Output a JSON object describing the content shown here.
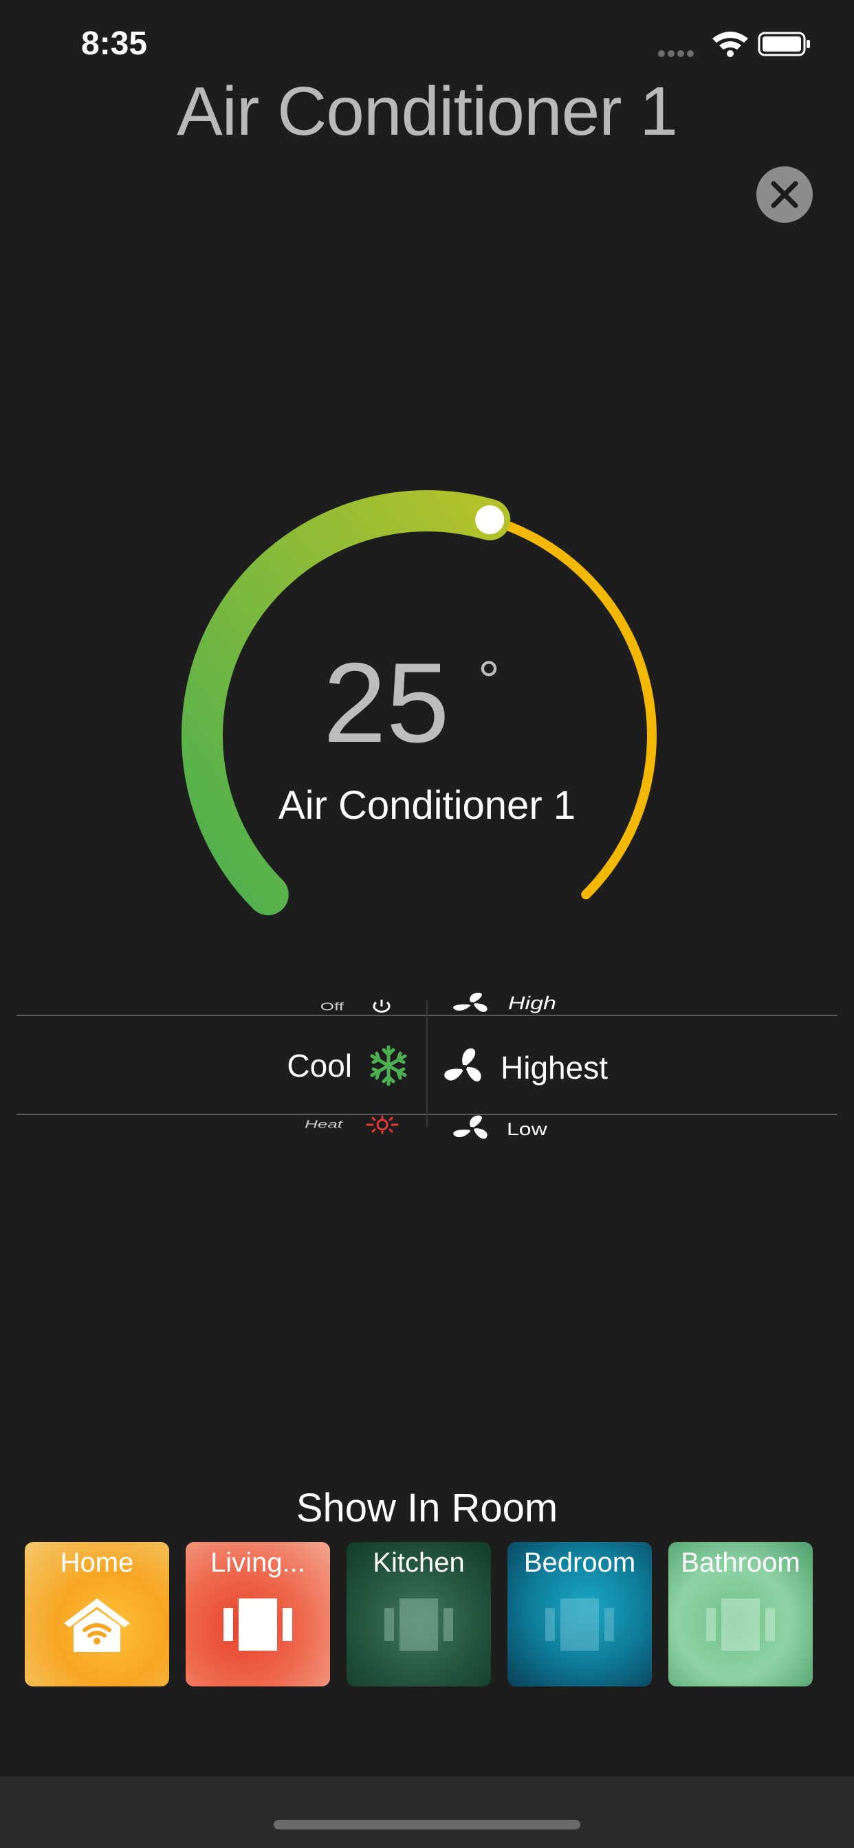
{
  "status_bar": {
    "time": "8:35"
  },
  "header": {
    "title": "Air Conditioner 1"
  },
  "thermostat": {
    "temperature": "25",
    "degree_symbol": "°",
    "device_name": "Air Conditioner 1",
    "level": 0.56,
    "colors": {
      "cool_start": "#4caf50",
      "cool_end": "#b3c22a",
      "heat": "#f5b800"
    }
  },
  "mode_picker": {
    "above": "Off",
    "selected": "Cool",
    "below": "Heat",
    "icons": [
      "power-icon",
      "snowflake-icon",
      "sun-icon"
    ]
  },
  "fan_picker": {
    "above": "High",
    "selected": "Highest",
    "below": "Low",
    "icon": "fan-icon"
  },
  "rooms": {
    "title": "Show In Room",
    "items": [
      {
        "label": "Home",
        "icon": "wifi-house-icon"
      },
      {
        "label": "Living...",
        "icon": "room-icon"
      },
      {
        "label": "Kitchen",
        "icon": "room-icon"
      },
      {
        "label": "Bedroom",
        "icon": "room-icon"
      },
      {
        "label": "Bathroom",
        "icon": "room-icon"
      }
    ]
  }
}
